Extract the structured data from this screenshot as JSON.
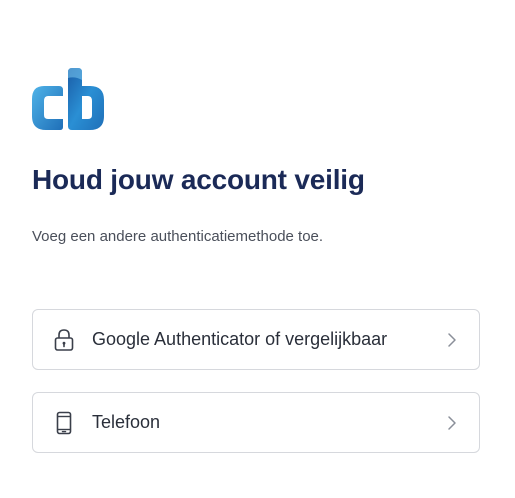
{
  "brand": {
    "logo_text": "cb",
    "colors": {
      "primary_blue": "#1f7fc4",
      "light_blue": "#4fb3e8",
      "navy": "#1b2a57"
    }
  },
  "page": {
    "title": "Houd jouw account veilig",
    "subtitle": "Voeg een andere authenticatiemethode toe."
  },
  "options": [
    {
      "label": "Google Authenticator of vergelijkbaar",
      "icon": "lock-icon",
      "chevron": "chevron-right-icon"
    },
    {
      "label": "Telefoon",
      "icon": "phone-icon",
      "chevron": "chevron-right-icon"
    }
  ]
}
